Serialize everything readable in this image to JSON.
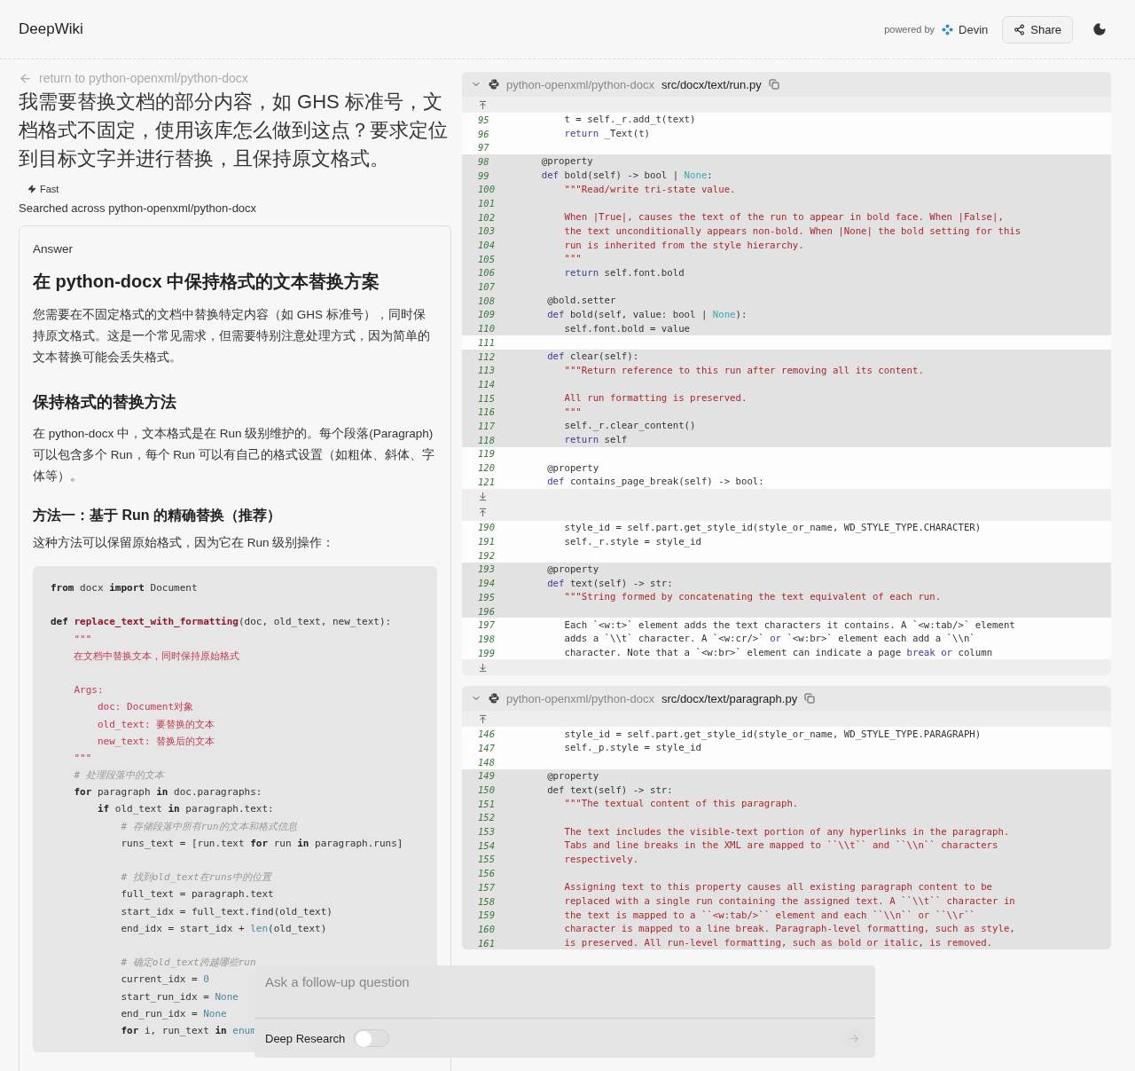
{
  "header": {
    "logo": "DeepWiki",
    "powered_by": "powered by",
    "brand": "Devin",
    "share": "Share"
  },
  "left": {
    "back_link": "return to python-openxml/python-docx",
    "question": "我需要替换文档的部分内容，如 GHS 标准号，文档格式不固定，使用该库怎么做到这点？要求定位到目标文字并进行替换，且保持原文格式。",
    "mode": "Fast",
    "searched": "Searched across python-openxml/python-docx",
    "answer": {
      "label": "Answer",
      "blocks": [
        {
          "kind": "h2",
          "text": "在 python-docx 中保持格式的文本替换方案"
        },
        {
          "kind": "p",
          "text": "您需要在不固定格式的文档中替换特定内容（如 GHS 标准号），同时保持原文格式。这是一个常见需求，但需要特别注意处理方式，因为简单的文本替换可能会丢失格式。"
        },
        {
          "kind": "h3",
          "text": "保持格式的替换方法"
        },
        {
          "kind": "p",
          "text": "在 python-docx 中，文本格式是在 Run 级别维护的。每个段落(Paragraph)可以包含多个 Run，每个 Run 可以有自己的格式设置（如粗体、斜体、字体等）。"
        },
        {
          "kind": "h4",
          "text": "方法一：基于 Run 的精确替换（推荐）"
        },
        {
          "kind": "p",
          "text": "这种方法可以保留原始格式，因为它在 Run 级别操作："
        },
        {
          "kind": "code",
          "lines": [
            {
              "kind": "code",
              "tokens": [
                {
                  "text": "from",
                  "kind": "keyword"
                },
                {
                  "text": " docx ",
                  "kind": "plain"
                },
                {
                  "text": "import",
                  "kind": "keyword"
                },
                {
                  "text": " Document",
                  "kind": "plain"
                }
              ]
            },
            {
              "kind": "blank"
            },
            {
              "kind": "code",
              "tokens": [
                {
                  "text": "def",
                  "kind": "keyword"
                },
                {
                  "text": " replace_text_with_formatting",
                  "kind": "function"
                },
                {
                  "text": "(doc, old_text, new_text):",
                  "kind": "plain"
                }
              ]
            },
            {
              "kind": "code",
              "tokens": [
                {
                  "text": "    \"\"\"",
                  "kind": "string"
                }
              ]
            },
            {
              "kind": "code",
              "tokens": [
                {
                  "text": "    在文档中替换文本，同时保持原始格式",
                  "kind": "string"
                }
              ]
            },
            {
              "kind": "blank"
            },
            {
              "kind": "code",
              "tokens": [
                {
                  "text": "    Args:",
                  "kind": "string"
                }
              ]
            },
            {
              "kind": "code",
              "tokens": [
                {
                  "text": "        doc: Document对象",
                  "kind": "string"
                }
              ]
            },
            {
              "kind": "code",
              "tokens": [
                {
                  "text": "        old_text: 要替换的文本",
                  "kind": "string"
                }
              ]
            },
            {
              "kind": "code",
              "tokens": [
                {
                  "text": "        new_text: 替换后的文本",
                  "kind": "string"
                }
              ]
            },
            {
              "kind": "code",
              "tokens": [
                {
                  "text": "    \"\"\"",
                  "kind": "string"
                }
              ]
            },
            {
              "kind": "code",
              "tokens": [
                {
                  "text": "    # 处理段落中的文本",
                  "kind": "comment"
                }
              ]
            },
            {
              "kind": "code",
              "tokens": [
                {
                  "text": "    for",
                  "kind": "keyword"
                },
                {
                  "text": " paragraph ",
                  "kind": "plain"
                },
                {
                  "text": "in",
                  "kind": "keyword"
                },
                {
                  "text": " doc.paragraphs:",
                  "kind": "plain"
                }
              ]
            },
            {
              "kind": "code",
              "tokens": [
                {
                  "text": "        if",
                  "kind": "keyword"
                },
                {
                  "text": " old_text ",
                  "kind": "plain"
                },
                {
                  "text": "in",
                  "kind": "keyword"
                },
                {
                  "text": " paragraph.text:",
                  "kind": "plain"
                }
              ]
            },
            {
              "kind": "code",
              "tokens": [
                {
                  "text": "            # 存储段落中所有run的文本和格式信息",
                  "kind": "comment"
                }
              ]
            },
            {
              "kind": "code",
              "tokens": [
                {
                  "text": "            runs_text = [run.text ",
                  "kind": "plain"
                },
                {
                  "text": "for",
                  "kind": "keyword"
                },
                {
                  "text": " run ",
                  "kind": "plain"
                },
                {
                  "text": "in",
                  "kind": "keyword"
                },
                {
                  "text": " paragraph.runs]",
                  "kind": "plain"
                }
              ]
            },
            {
              "kind": "blank"
            },
            {
              "kind": "code",
              "tokens": [
                {
                  "text": "            # 找到old_text在runs中的位置",
                  "kind": "comment"
                }
              ]
            },
            {
              "kind": "code",
              "tokens": [
                {
                  "text": "            full_text = paragraph.text",
                  "kind": "plain"
                }
              ]
            },
            {
              "kind": "code",
              "tokens": [
                {
                  "text": "            start_idx = full_text.find(old_text)",
                  "kind": "plain"
                }
              ]
            },
            {
              "kind": "code",
              "tokens": [
                {
                  "text": "            end_idx = start_idx + ",
                  "kind": "plain"
                },
                {
                  "text": "len",
                  "kind": "constant"
                },
                {
                  "text": "(old_text)",
                  "kind": "plain"
                }
              ]
            },
            {
              "kind": "blank"
            },
            {
              "kind": "code",
              "tokens": [
                {
                  "text": "            # 确定old_text跨越哪些run",
                  "kind": "comment"
                }
              ]
            },
            {
              "kind": "code",
              "tokens": [
                {
                  "text": "            current_idx = ",
                  "kind": "plain"
                },
                {
                  "text": "0",
                  "kind": "constant"
                }
              ]
            },
            {
              "kind": "code",
              "tokens": [
                {
                  "text": "            start_run_idx = ",
                  "kind": "plain"
                },
                {
                  "text": "None",
                  "kind": "constant"
                }
              ]
            },
            {
              "kind": "code",
              "tokens": [
                {
                  "text": "            end_run_idx = ",
                  "kind": "plain"
                },
                {
                  "text": "None",
                  "kind": "constant"
                }
              ]
            },
            {
              "kind": "code",
              "tokens": [
                {
                  "text": "            for",
                  "kind": "keyword"
                },
                {
                  "text": " i, run_text ",
                  "kind": "plain"
                },
                {
                  "text": "in",
                  "kind": "keyword"
                },
                {
                  "text": " enum",
                  "kind": "constant"
                }
              ]
            }
          ]
        }
      ]
    }
  },
  "files": [
    {
      "repo": "python-openxml/python-docx",
      "path": "src/docx/text/run.py",
      "expanded": true,
      "rows": [
        {
          "kind": "expand_up"
        },
        {
          "kind": "line",
          "n": "95",
          "highlighted": false,
          "tokens": [
            {
              "text": "        t = self._r.add_t(text)",
              "kind": "plain"
            }
          ]
        },
        {
          "kind": "line",
          "n": "96",
          "highlighted": false,
          "tokens": [
            {
              "text": "        return",
              "kind": "keyword"
            },
            {
              "text": " _Text(t)",
              "kind": "plain"
            }
          ]
        },
        {
          "kind": "line",
          "n": "97",
          "highlighted": false
        },
        {
          "kind": "line",
          "n": "98",
          "highlighted": true,
          "tokens": [
            {
              "text": "    @property",
              "kind": "plain"
            }
          ]
        },
        {
          "kind": "line",
          "n": "99",
          "highlighted": true,
          "tokens": [
            {
              "text": "    def",
              "kind": "keyword"
            },
            {
              "text": " bold(self) -> bool | ",
              "kind": "plain"
            },
            {
              "text": "None",
              "kind": "constant"
            },
            {
              "text": ":",
              "kind": "plain"
            }
          ]
        },
        {
          "kind": "line",
          "n": "100",
          "highlighted": true,
          "tokens": [
            {
              "text": "        \"\"\"Read/write tri-state value.",
              "kind": "string"
            }
          ]
        },
        {
          "kind": "line",
          "n": "101",
          "highlighted": true
        },
        {
          "kind": "line",
          "n": "102",
          "highlighted": true,
          "tokens": [
            {
              "text": "        When |True|, causes the text of the run to appear in bold face. When |False|,",
              "kind": "string"
            }
          ]
        },
        {
          "kind": "line",
          "n": "103",
          "highlighted": true,
          "tokens": [
            {
              "text": "        the text unconditionally appears non-bold. When |None| the bold setting for this",
              "kind": "string"
            }
          ]
        },
        {
          "kind": "line",
          "n": "104",
          "highlighted": true,
          "tokens": [
            {
              "text": "        run is inherited from the style hierarchy.",
              "kind": "string"
            }
          ]
        },
        {
          "kind": "line",
          "n": "105",
          "highlighted": true,
          "tokens": [
            {
              "text": "        \"\"\"",
              "kind": "string"
            }
          ]
        },
        {
          "kind": "line",
          "n": "106",
          "highlighted": true,
          "tokens": [
            {
              "text": "        return",
              "kind": "keyword"
            },
            {
              "text": " self.font.bold",
              "kind": "plain"
            }
          ]
        },
        {
          "kind": "line",
          "n": "107",
          "highlighted": true
        },
        {
          "kind": "line",
          "n": "108",
          "highlighted": true,
          "tokens": [
            {
              "text": "     @bold.setter",
              "kind": "plain"
            }
          ]
        },
        {
          "kind": "line",
          "n": "109",
          "highlighted": true,
          "tokens": [
            {
              "text": "     def",
              "kind": "keyword"
            },
            {
              "text": " bold(self, value: bool | ",
              "kind": "plain"
            },
            {
              "text": "None",
              "kind": "constant"
            },
            {
              "text": "):",
              "kind": "plain"
            }
          ]
        },
        {
          "kind": "line",
          "n": "110",
          "highlighted": true,
          "tokens": [
            {
              "text": "        self.font.bold = value",
              "kind": "plain"
            }
          ]
        },
        {
          "kind": "line",
          "n": "111",
          "highlighted": false
        },
        {
          "kind": "line",
          "n": "112",
          "highlighted": true,
          "tokens": [
            {
              "text": "     def",
              "kind": "keyword"
            },
            {
              "text": " clear(self):",
              "kind": "plain"
            }
          ]
        },
        {
          "kind": "line",
          "n": "113",
          "highlighted": true,
          "tokens": [
            {
              "text": "        \"\"\"Return reference to this run after removing all its content.",
              "kind": "string"
            }
          ]
        },
        {
          "kind": "line",
          "n": "114",
          "highlighted": true
        },
        {
          "kind": "line",
          "n": "115",
          "highlighted": true,
          "tokens": [
            {
              "text": "        All run formatting is preserved.",
              "kind": "string"
            }
          ]
        },
        {
          "kind": "line",
          "n": "116",
          "highlighted": true,
          "tokens": [
            {
              "text": "        \"\"\"",
              "kind": "string"
            }
          ]
        },
        {
          "kind": "line",
          "n": "117",
          "highlighted": true,
          "tokens": [
            {
              "text": "        self._r.clear_content()",
              "kind": "plain"
            }
          ]
        },
        {
          "kind": "line",
          "n": "118",
          "highlighted": true,
          "tokens": [
            {
              "text": "        return",
              "kind": "keyword"
            },
            {
              "text": " self",
              "kind": "plain"
            }
          ]
        },
        {
          "kind": "line",
          "n": "119",
          "highlighted": false
        },
        {
          "kind": "line",
          "n": "120",
          "highlighted": false,
          "tokens": [
            {
              "text": "     @property",
              "kind": "plain"
            }
          ]
        },
        {
          "kind": "line",
          "n": "121",
          "highlighted": false,
          "tokens": [
            {
              "text": "     def",
              "kind": "keyword"
            },
            {
              "text": " contains_page_break(self) -> bool:",
              "kind": "plain"
            }
          ]
        },
        {
          "kind": "expand_down"
        },
        {
          "kind": "expand_up"
        },
        {
          "kind": "line",
          "n": "190",
          "highlighted": false,
          "tokens": [
            {
              "text": "        style_id = self.part.get_style_id(style_or_name, WD_STYLE_TYPE.CHARACTER)",
              "kind": "plain"
            }
          ]
        },
        {
          "kind": "line",
          "n": "191",
          "highlighted": false,
          "tokens": [
            {
              "text": "        self._r.style = style_id",
              "kind": "plain"
            }
          ]
        },
        {
          "kind": "line",
          "n": "192",
          "highlighted": false
        },
        {
          "kind": "line",
          "n": "193",
          "highlighted": true,
          "tokens": [
            {
              "text": "     @property",
              "kind": "plain"
            }
          ]
        },
        {
          "kind": "line",
          "n": "194",
          "highlighted": true,
          "tokens": [
            {
              "text": "     def",
              "kind": "keyword"
            },
            {
              "text": " text(self) -> str:",
              "kind": "plain"
            }
          ]
        },
        {
          "kind": "line",
          "n": "195",
          "highlighted": true,
          "tokens": [
            {
              "text": "        \"\"\"String formed by concatenating the text equivalent of each run.",
              "kind": "string"
            }
          ]
        },
        {
          "kind": "line",
          "n": "196",
          "highlighted": true
        },
        {
          "kind": "line",
          "n": "197",
          "highlighted": false,
          "tokens": [
            {
              "text": "        Each `<w:t>` element adds the text characters it contains. A `<w:tab/>` element",
              "kind": "plain"
            }
          ]
        },
        {
          "kind": "line",
          "n": "198",
          "highlighted": false,
          "tokens": [
            {
              "text": "        adds a `\\\\t` character. A `<w:cr/>` ",
              "kind": "plain"
            },
            {
              "text": "or",
              "kind": "keyword"
            },
            {
              "text": " `<w:br>` element each add a `\\\\n`",
              "kind": "plain"
            }
          ]
        },
        {
          "kind": "line",
          "n": "199",
          "highlighted": false,
          "tokens": [
            {
              "text": "        character. Note that a `<w:br>` element can indicate a page ",
              "kind": "plain"
            },
            {
              "text": "break or",
              "kind": "keyword"
            },
            {
              "text": " column",
              "kind": "plain"
            }
          ]
        },
        {
          "kind": "expand_down"
        }
      ]
    },
    {
      "repo": "python-openxml/python-docx",
      "path": "src/docx/text/paragraph.py",
      "expanded": true,
      "rows": [
        {
          "kind": "expand_up"
        },
        {
          "kind": "line",
          "n": "146",
          "highlighted": false,
          "tokens": [
            {
              "text": "        style_id = self.part.get_style_id(style_or_name, WD_STYLE_TYPE.PARAGRAPH)",
              "kind": "plain"
            }
          ]
        },
        {
          "kind": "line",
          "n": "147",
          "highlighted": false,
          "tokens": [
            {
              "text": "        self._p.style = style_id",
              "kind": "plain"
            }
          ]
        },
        {
          "kind": "line",
          "n": "148",
          "highlighted": false
        },
        {
          "kind": "line",
          "n": "149",
          "highlighted": true,
          "tokens": [
            {
              "text": "     @property",
              "kind": "plain"
            }
          ]
        },
        {
          "kind": "line",
          "n": "150",
          "highlighted": true,
          "tokens": [
            {
              "text": "     def text(self) -> str:",
              "kind": "plain"
            }
          ]
        },
        {
          "kind": "line",
          "n": "151",
          "highlighted": true,
          "tokens": [
            {
              "text": "        \"\"\"The textual content of this paragraph.",
              "kind": "string"
            }
          ]
        },
        {
          "kind": "line",
          "n": "152",
          "highlighted": true
        },
        {
          "kind": "line",
          "n": "153",
          "highlighted": true,
          "tokens": [
            {
              "text": "        The text includes the visible-text portion of any hyperlinks in the paragraph.",
              "kind": "string"
            }
          ]
        },
        {
          "kind": "line",
          "n": "154",
          "highlighted": true,
          "tokens": [
            {
              "text": "        Tabs and line breaks in the XML are mapped to ``\\\\t`` and ``\\\\n`` characters",
              "kind": "string"
            }
          ]
        },
        {
          "kind": "line",
          "n": "155",
          "highlighted": true,
          "tokens": [
            {
              "text": "        respectively.",
              "kind": "string"
            }
          ]
        },
        {
          "kind": "line",
          "n": "156",
          "highlighted": true
        },
        {
          "kind": "line",
          "n": "157",
          "highlighted": true,
          "tokens": [
            {
              "text": "        Assigning text to this property causes all existing paragraph content to be",
              "kind": "string"
            }
          ]
        },
        {
          "kind": "line",
          "n": "158",
          "highlighted": true,
          "tokens": [
            {
              "text": "        replaced with a single run containing the assigned text. A ``\\\\t`` character in",
              "kind": "string"
            }
          ]
        },
        {
          "kind": "line",
          "n": "159",
          "highlighted": true,
          "tokens": [
            {
              "text": "        the text is mapped to a ``<w:tab/>`` element and each ``\\\\n`` or ``\\\\r``",
              "kind": "string"
            }
          ]
        },
        {
          "kind": "line",
          "n": "160",
          "highlighted": true,
          "tokens": [
            {
              "text": "        character is mapped to a line break. Paragraph-level formatting, such as style,",
              "kind": "string"
            }
          ]
        },
        {
          "kind": "line",
          "n": "161",
          "highlighted": true,
          "tokens": [
            {
              "text": "        is preserved. All run-level formatting, such as bold or italic, is removed.",
              "kind": "string"
            }
          ]
        }
      ]
    }
  ],
  "follow_up": {
    "placeholder": "Ask a follow-up question",
    "deep_research": {
      "label": "Deep Research",
      "on": false
    }
  }
}
